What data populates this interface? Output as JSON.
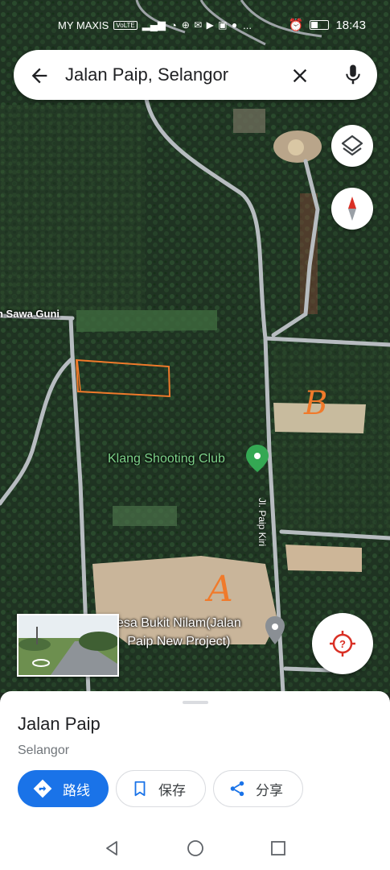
{
  "status": {
    "carrier": "MY MAXIS",
    "volte": "VoLTE",
    "notif_icons": "⊕ ✉ ▶ ▣ ●",
    "dots": "...",
    "time": "18:43"
  },
  "search": {
    "query": "Jalan Paip, Selangor"
  },
  "map": {
    "labels": {
      "sawa": "n Sawa Guni",
      "klang": "Klang Shooting Club",
      "jl_paip": "Jl. Paip Kiri",
      "desa_line1": "esa Bukit Nilam(Jalan",
      "desa_line2": "Paip New Project)"
    },
    "annotations": {
      "a": "A",
      "b": "B"
    },
    "colors": {
      "road": "#b7bcc0",
      "pin_green": "#34a853",
      "pin_grey": "#8a8f94",
      "annotation": "#f07a2b",
      "locate_red": "#d93025"
    }
  },
  "place": {
    "title": "Jalan Paip",
    "subtitle": "Selangor",
    "actions": {
      "directions": "路线",
      "save": "保存",
      "share": "分享"
    },
    "accent": "#1a73e8"
  }
}
